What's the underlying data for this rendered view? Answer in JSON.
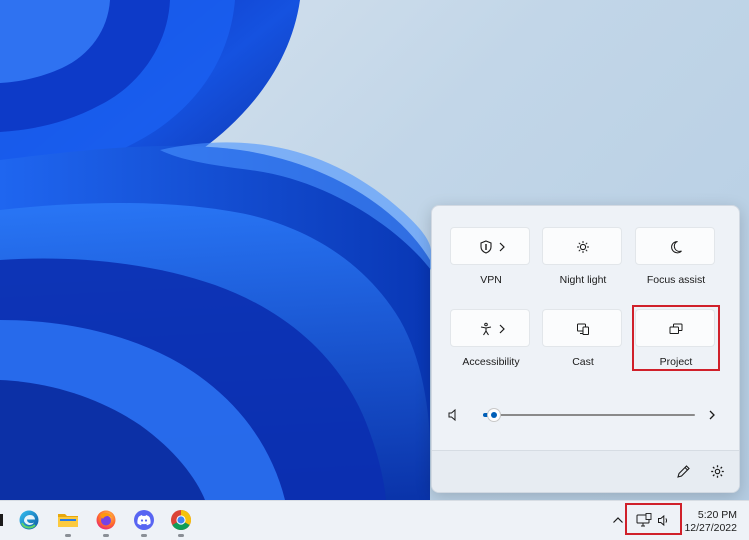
{
  "quick_settings": {
    "tiles": [
      {
        "label": "VPN",
        "icon": "shield-icon",
        "has_submenu": true
      },
      {
        "label": "Night light",
        "icon": "brightness-icon",
        "has_submenu": false
      },
      {
        "label": "Focus assist",
        "icon": "moon-icon",
        "has_submenu": false
      },
      {
        "label": "Accessibility",
        "icon": "accessibility-icon",
        "has_submenu": true
      },
      {
        "label": "Cast",
        "icon": "cast-icon",
        "has_submenu": false
      },
      {
        "label": "Project",
        "icon": "project-icon",
        "has_submenu": false
      }
    ],
    "volume": {
      "icon": "speaker-icon",
      "level": 0.05
    },
    "footer": {
      "edit_icon": "pencil-icon",
      "settings_icon": "gear-icon"
    }
  },
  "taskbar": {
    "apps": [
      "edge-icon",
      "file-explorer-icon",
      "firefox-icon",
      "discord-icon",
      "chrome-icon"
    ],
    "tray": {
      "overflow_icon": "chevron-up-icon",
      "network_icon": "network-icon",
      "volume_icon": "speaker-icon"
    },
    "clock": {
      "time": "5:20 PM",
      "date": "12/27/2022"
    }
  },
  "colors": {
    "accent": "#005fb8",
    "highlight": "#d0202a"
  }
}
